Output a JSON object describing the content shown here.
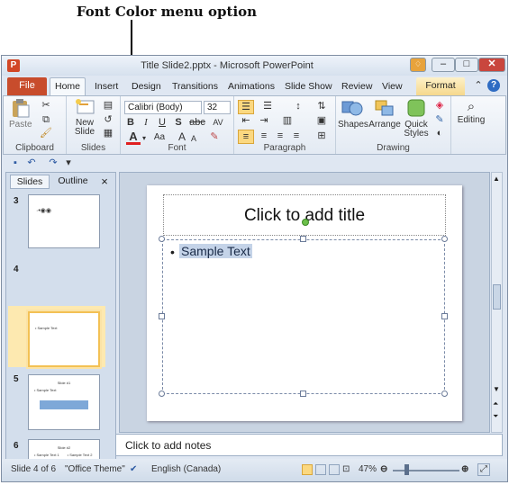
{
  "annotation": {
    "label": "Font Color menu option"
  },
  "window": {
    "title": "Title Slide2.pptx - Microsoft PowerPoint",
    "app_icon": "P",
    "minimize": "–",
    "maximize": "□",
    "close": "✕",
    "help_mini": "♢"
  },
  "tabs": {
    "file": "File",
    "home": "Home",
    "insert": "Insert",
    "design": "Design",
    "transitions": "Transitions",
    "animations": "Animations",
    "slide_show": "Slide Show",
    "review": "Review",
    "view": "View",
    "format": "Format"
  },
  "ribbon": {
    "clipboard": {
      "label": "Clipboard",
      "paste": "Paste"
    },
    "slides": {
      "label": "Slides",
      "new_slide": "New",
      "new_slide2": "Slide"
    },
    "font": {
      "label": "Font",
      "font_name": "Calibri (Body)",
      "font_size": "32",
      "bold": "B",
      "italic": "I",
      "underline": "U",
      "strike": "S",
      "abc": "abc",
      "spacing": "AV",
      "font_color": "A",
      "case": "Aa",
      "grow": "A",
      "shrink": "A"
    },
    "paragraph": {
      "label": "Paragraph"
    },
    "drawing": {
      "label": "Drawing",
      "shapes": "Shapes",
      "arrange": "Arrange",
      "quick_styles": "Quick",
      "quick_styles2": "Styles"
    },
    "editing": {
      "label": "Editing"
    }
  },
  "slides_pane": {
    "tab_slides": "Slides",
    "tab_outline": "Outline",
    "close": "×",
    "thumbs": [
      {
        "num": "3",
        "text": "·•◉◉"
      },
      {
        "num": "4",
        "text": "• Sample Text"
      },
      {
        "num": "5",
        "title": "Slide #1",
        "text": "• Sample Text"
      },
      {
        "num": "6",
        "title": "Slide #2",
        "text": "• Sample Text 1        • Sample Text 2"
      }
    ]
  },
  "slide": {
    "title_placeholder": "Click to add title",
    "body_text": "Sample Text"
  },
  "notes": {
    "placeholder": "Click to add notes"
  },
  "status": {
    "slide_info": "Slide 4 of 6",
    "theme": "\"Office Theme\"",
    "language": "English (Canada)",
    "zoom": "47%"
  },
  "colors": {
    "file_tab": "#c84c2c",
    "font_color_bar": "#e02020",
    "selection": "#fde9b0"
  }
}
